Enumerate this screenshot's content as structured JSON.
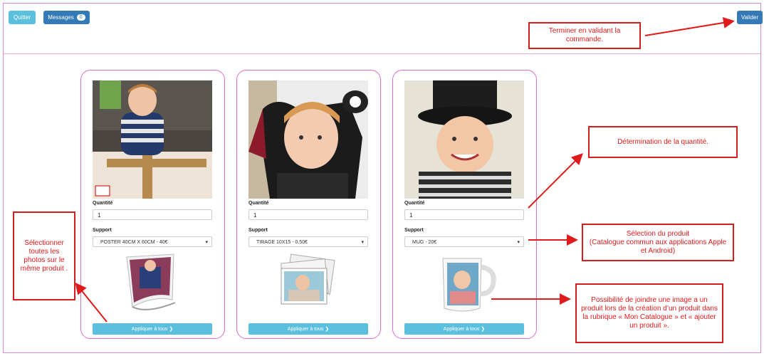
{
  "toolbar": {
    "quit_label": "Quitter",
    "messages_label": "Messages",
    "messages_count": "0",
    "validate_label": "Valider"
  },
  "cards": [
    {
      "quantity_label": "Quantité",
      "quantity_value": "1",
      "support_label": "Support",
      "support_value": "POSTER 40CM X 60CM - 40€",
      "apply_label": "Appliquer à tous ❯"
    },
    {
      "quantity_label": "Quantité",
      "quantity_value": "1",
      "support_label": "Support",
      "support_value": "TIRAGE 10X15 - 0.50€",
      "apply_label": "Appliquer à tous ❯"
    },
    {
      "quantity_label": "Quantité",
      "quantity_value": "1",
      "support_label": "Support",
      "support_value": "MUG - 20€",
      "apply_label": "Appliquer à tous ❯"
    }
  ],
  "annotations": {
    "finish": "Terminer en validant la commande.",
    "quantity": "Détermination de la quantité.",
    "product": "Sélection du produit\n(Catalogue commun aux applications Apple et Android)",
    "image": "Possibilité de joindre une image a un produit lors de la création d’un produit dans la rubrique « Mon Catalogue » et « ajouter un produit ».",
    "select_all": "Sélectionner toutes les photos sur le même produit ."
  },
  "colors": {
    "annotation_red": "#e01b1b",
    "card_border": "#d86ecf",
    "info_button": "#5bc0de",
    "primary_button": "#337ab7"
  }
}
